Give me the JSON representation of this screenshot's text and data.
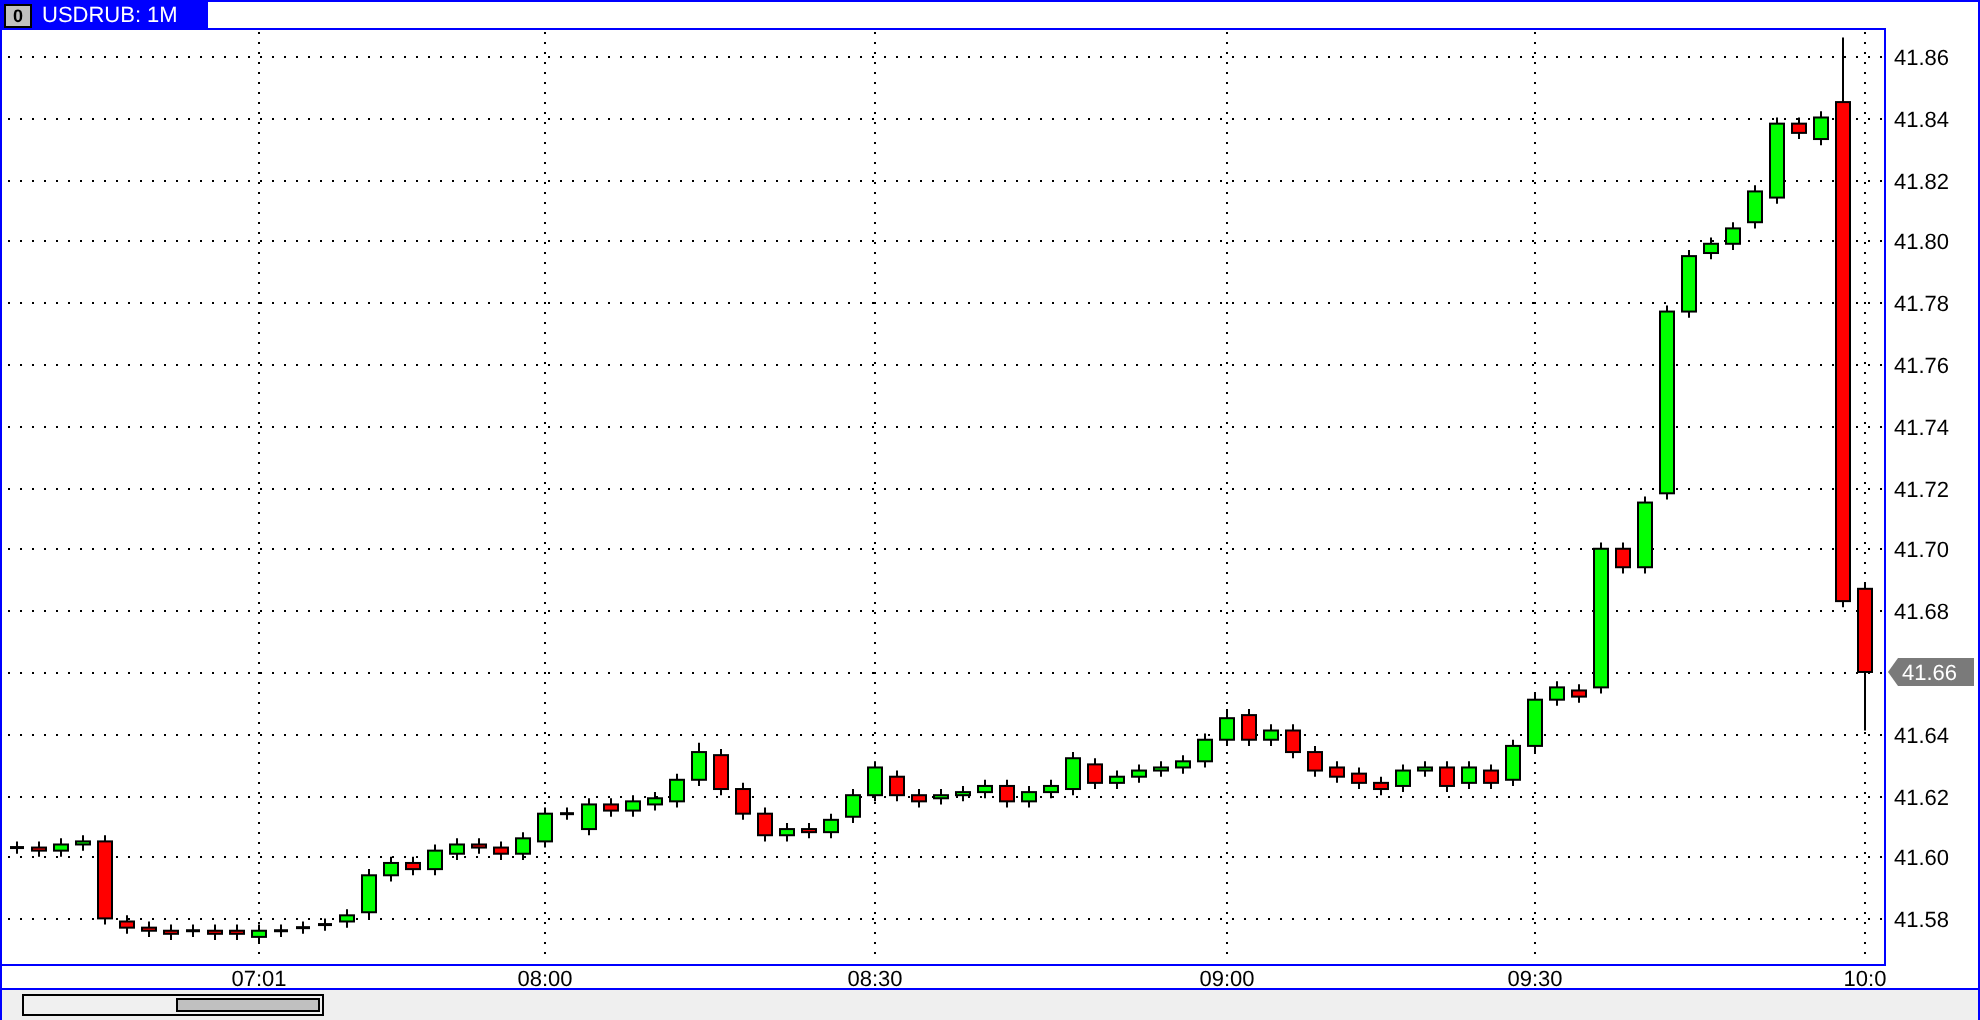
{
  "window": {
    "icon_glyph": "0",
    "title": "USDRUB: 1M"
  },
  "chart": {
    "last_price": "41.66",
    "chart_data": {
      "type": "candlestick",
      "grid": true,
      "ylim": [
        41.5652,
        41.8684
      ],
      "categories": [
        null,
        null,
        null,
        null,
        null,
        null,
        null,
        null,
        null,
        null,
        null,
        "07:01",
        null,
        null,
        null,
        null,
        null,
        null,
        null,
        null,
        null,
        null,
        null,
        null,
        "08:00",
        null,
        null,
        null,
        null,
        null,
        null,
        null,
        null,
        null,
        null,
        null,
        null,
        null,
        null,
        "08:30",
        null,
        null,
        null,
        null,
        null,
        null,
        null,
        null,
        null,
        null,
        null,
        null,
        null,
        null,
        null,
        "09:00",
        null,
        null,
        null,
        null,
        null,
        null,
        null,
        null,
        null,
        null,
        null,
        null,
        null,
        "09:30",
        null,
        null,
        null,
        null,
        null,
        null,
        null,
        null,
        null,
        null,
        null,
        null,
        null,
        null,
        "10:0"
      ],
      "yticks": [
        {
          "value": 41.58,
          "label": "41.58"
        },
        {
          "value": 41.6,
          "label": "41.60"
        },
        {
          "value": 41.62,
          "label": "41.62"
        },
        {
          "value": 41.64,
          "label": "41.64"
        },
        {
          "value": 41.68,
          "label": "41.68"
        },
        {
          "value": 41.7,
          "label": "41.70"
        },
        {
          "value": 41.72,
          "label": "41.72"
        },
        {
          "value": 41.74,
          "label": "41.74"
        },
        {
          "value": 41.76,
          "label": "41.76"
        },
        {
          "value": 41.78,
          "label": "41.78"
        },
        {
          "value": 41.8,
          "label": "41.80"
        },
        {
          "value": 41.82,
          "label": "41.82"
        },
        {
          "value": 41.84,
          "label": "41.84"
        },
        {
          "value": 41.86,
          "label": "41.86"
        }
      ],
      "ohlc": [
        [
          41.603,
          41.605,
          41.601,
          41.603
        ],
        [
          41.603,
          41.605,
          41.6,
          41.602
        ],
        [
          41.602,
          41.606,
          41.6,
          41.604
        ],
        [
          41.604,
          41.607,
          41.602,
          41.605
        ],
        [
          41.605,
          41.607,
          41.578,
          41.58
        ],
        [
          41.579,
          41.581,
          41.575,
          41.577
        ],
        [
          41.577,
          41.579,
          41.574,
          41.576
        ],
        [
          41.576,
          41.578,
          41.573,
          41.575
        ],
        [
          41.576,
          41.578,
          41.574,
          41.576
        ],
        [
          41.576,
          41.578,
          41.573,
          41.575
        ],
        [
          41.576,
          41.578,
          41.573,
          41.575
        ],
        [
          41.574,
          41.578,
          41.572,
          41.576
        ],
        [
          41.576,
          41.578,
          41.574,
          41.576
        ],
        [
          41.577,
          41.579,
          41.575,
          41.577
        ],
        [
          41.578,
          41.58,
          41.576,
          41.578
        ],
        [
          41.579,
          41.583,
          41.577,
          41.581
        ],
        [
          41.582,
          41.596,
          41.58,
          41.594
        ],
        [
          41.594,
          41.6,
          41.592,
          41.598
        ],
        [
          41.598,
          41.6,
          41.594,
          41.596
        ],
        [
          41.596,
          41.604,
          41.594,
          41.602
        ],
        [
          41.601,
          41.606,
          41.599,
          41.604
        ],
        [
          41.604,
          41.606,
          41.601,
          41.603
        ],
        [
          41.603,
          41.605,
          41.599,
          41.601
        ],
        [
          41.601,
          41.608,
          41.599,
          41.606
        ],
        [
          41.605,
          41.616,
          41.603,
          41.614
        ],
        [
          41.614,
          41.616,
          41.612,
          41.614
        ],
        [
          41.609,
          41.619,
          41.607,
          41.617
        ],
        [
          41.617,
          41.619,
          41.613,
          41.615
        ],
        [
          41.615,
          41.62,
          41.613,
          41.618
        ],
        [
          41.617,
          41.621,
          41.615,
          41.619
        ],
        [
          41.618,
          41.627,
          41.616,
          41.625
        ],
        [
          41.625,
          41.637,
          41.623,
          41.634
        ],
        [
          41.633,
          41.635,
          41.62,
          41.622
        ],
        [
          41.622,
          41.624,
          41.612,
          41.614
        ],
        [
          41.614,
          41.616,
          41.605,
          41.607
        ],
        [
          41.607,
          41.611,
          41.605,
          41.609
        ],
        [
          41.609,
          41.611,
          41.606,
          41.608
        ],
        [
          41.608,
          41.614,
          41.606,
          41.612
        ],
        [
          41.613,
          41.622,
          41.611,
          41.62
        ],
        [
          41.62,
          41.631,
          41.618,
          41.629
        ],
        [
          41.626,
          41.628,
          41.618,
          41.62
        ],
        [
          41.62,
          41.622,
          41.616,
          41.618
        ],
        [
          41.619,
          41.622,
          41.617,
          41.62
        ],
        [
          41.62,
          41.623,
          41.618,
          41.621
        ],
        [
          41.621,
          41.625,
          41.619,
          41.623
        ],
        [
          41.623,
          41.625,
          41.616,
          41.618
        ],
        [
          41.618,
          41.623,
          41.616,
          41.621
        ],
        [
          41.621,
          41.625,
          41.619,
          41.623
        ],
        [
          41.622,
          41.634,
          41.62,
          41.632
        ],
        [
          41.63,
          41.632,
          41.622,
          41.624
        ],
        [
          41.624,
          41.628,
          41.622,
          41.626
        ],
        [
          41.626,
          41.63,
          41.624,
          41.628
        ],
        [
          41.628,
          41.631,
          41.626,
          41.629
        ],
        [
          41.629,
          41.633,
          41.627,
          41.631
        ],
        [
          41.631,
          41.64,
          41.629,
          41.638
        ],
        [
          41.638,
          41.648,
          41.636,
          41.645
        ],
        [
          41.646,
          41.648,
          41.636,
          41.638
        ],
        [
          41.638,
          41.643,
          41.636,
          41.641
        ],
        [
          41.641,
          41.643,
          41.632,
          41.634
        ],
        [
          41.634,
          41.636,
          41.626,
          41.628
        ],
        [
          41.629,
          41.631,
          41.624,
          41.626
        ],
        [
          41.627,
          41.629,
          41.622,
          41.624
        ],
        [
          41.624,
          41.626,
          41.62,
          41.622
        ],
        [
          41.623,
          41.63,
          41.621,
          41.628
        ],
        [
          41.628,
          41.631,
          41.626,
          41.629
        ],
        [
          41.629,
          41.631,
          41.621,
          41.623
        ],
        [
          41.624,
          41.631,
          41.622,
          41.629
        ],
        [
          41.628,
          41.63,
          41.622,
          41.624
        ],
        [
          41.625,
          41.638,
          41.623,
          41.636
        ],
        [
          41.636,
          41.653,
          41.634,
          41.651
        ],
        [
          41.651,
          41.657,
          41.649,
          41.655
        ],
        [
          41.654,
          41.656,
          41.65,
          41.652
        ],
        [
          41.655,
          41.702,
          41.653,
          41.7
        ],
        [
          41.7,
          41.702,
          41.692,
          41.694
        ],
        [
          41.694,
          41.717,
          41.692,
          41.715
        ],
        [
          41.718,
          41.779,
          41.716,
          41.777
        ],
        [
          41.777,
          41.797,
          41.775,
          41.795
        ],
        [
          41.796,
          41.801,
          41.794,
          41.799
        ],
        [
          41.799,
          41.806,
          41.797,
          41.804
        ],
        [
          41.806,
          41.818,
          41.804,
          41.816
        ],
        [
          41.814,
          41.84,
          41.812,
          41.838
        ],
        [
          41.838,
          41.84,
          41.833,
          41.835
        ],
        [
          41.833,
          41.842,
          41.831,
          41.84
        ],
        [
          41.845,
          41.866,
          41.681,
          41.683
        ],
        [
          41.687,
          41.689,
          41.641,
          41.66
        ]
      ]
    }
  }
}
